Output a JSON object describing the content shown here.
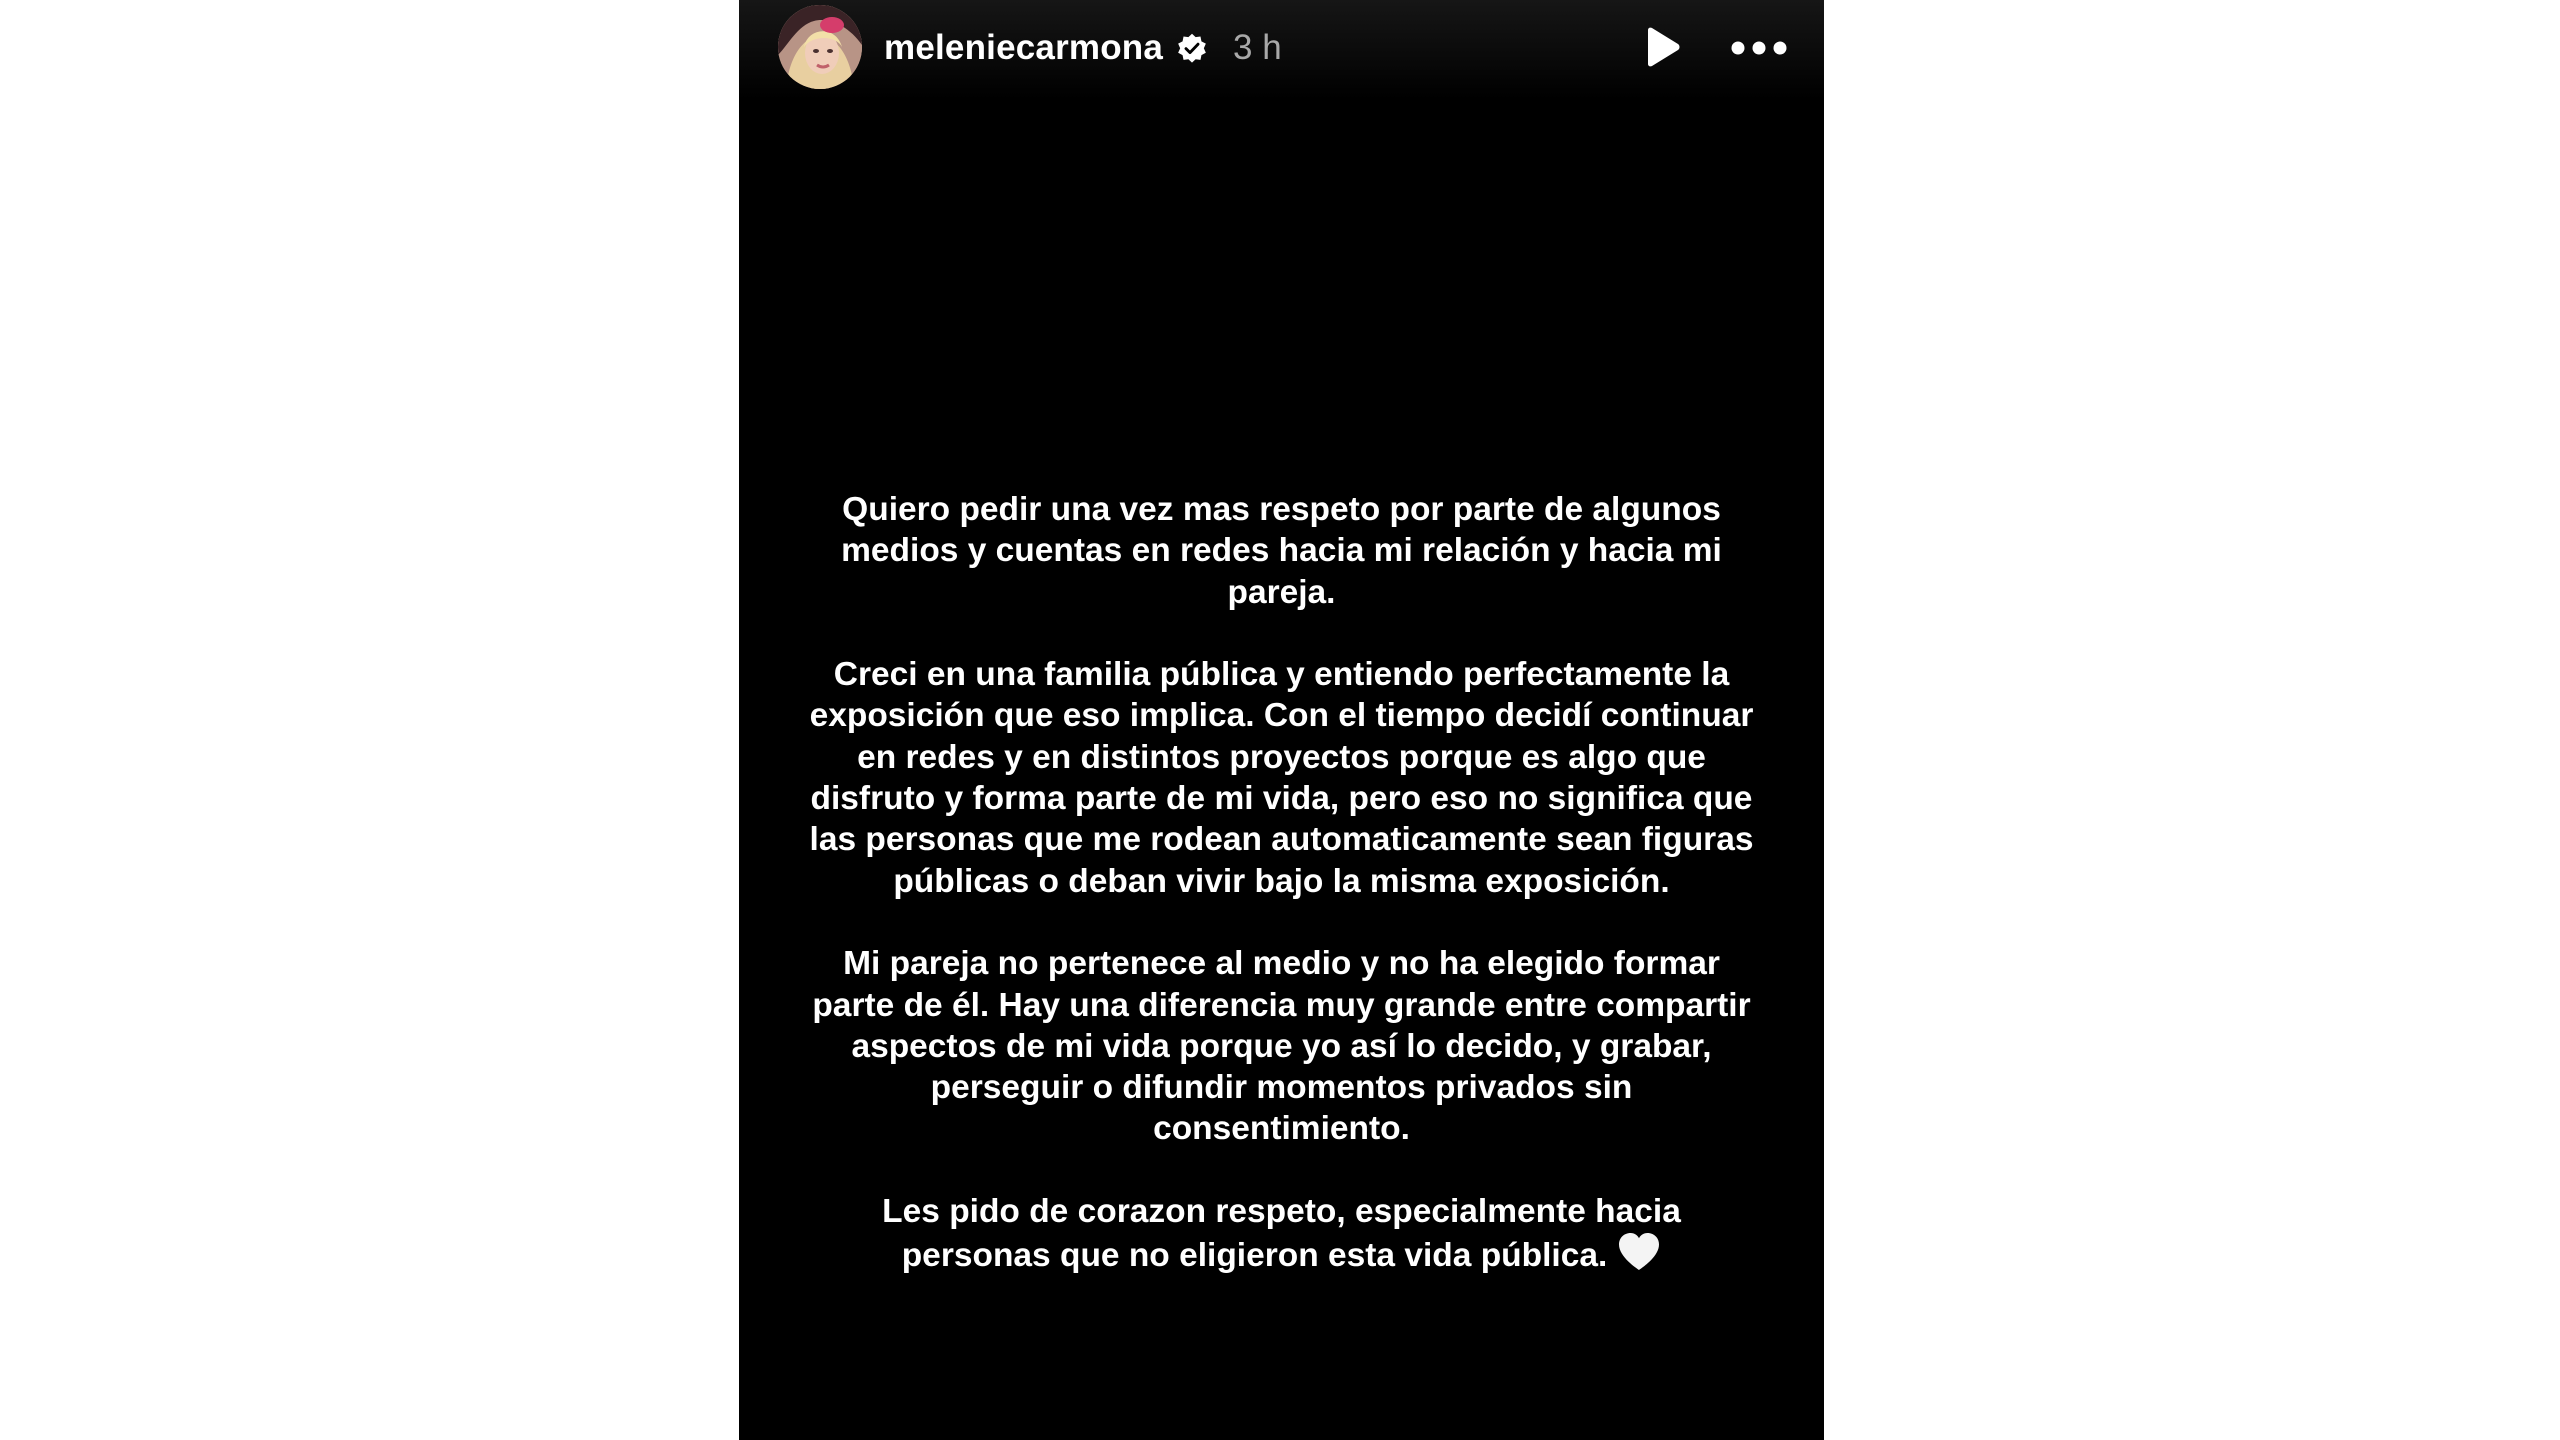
{
  "story": {
    "username": "meleniecarmona",
    "verified": true,
    "timestamp": "3 h",
    "controls": {
      "play_icon": "play-icon",
      "more_icon": "more-options-icon"
    },
    "paragraphs": [
      "Quiero pedir una vez mas respeto por parte de algunos medios y cuentas en redes hacia mi relación y hacia mi pareja.",
      "Creci en una familia pública y entiendo perfectamente la exposición que eso implica. Con el tiempo decidí continuar en redes y en distintos proyectos porque es algo que disfruto y forma parte de mi vida, pero eso no significa que las personas que me rodean automaticamente sean figuras públicas o deban vivir bajo la misma exposición.",
      "Mi pareja no pertenece al medio y no ha elegido formar parte de él. Hay una diferencia muy grande entre compartir aspectos de mi vida porque yo así lo decido, y grabar, perseguir o difundir momentos privados sin consentimiento.",
      "Les pido de corazon respeto, especialmente hacia personas que no eligieron esta vida pública."
    ],
    "end_emoji": "white-heart-icon"
  },
  "colors": {
    "page_background": "#ffffff",
    "story_background": "#000000",
    "text": "#ffffff",
    "timestamp": "#a8a8a8"
  }
}
